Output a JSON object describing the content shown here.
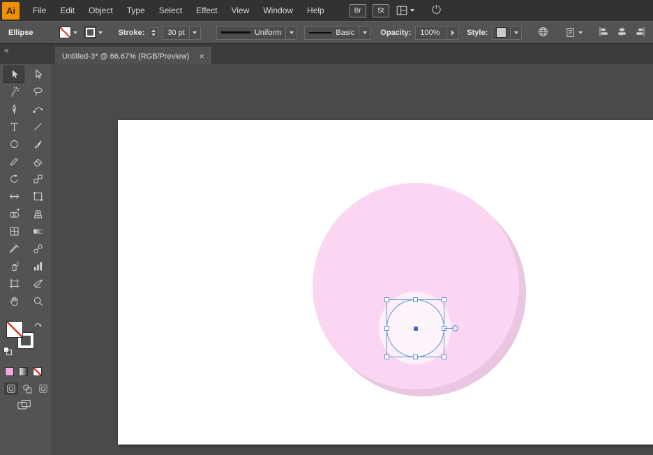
{
  "menu": {
    "logo_text": "Ai",
    "items": [
      "File",
      "Edit",
      "Object",
      "Type",
      "Select",
      "Effect",
      "View",
      "Window",
      "Help"
    ],
    "bridge_badge": "Br",
    "stock_badge": "St"
  },
  "control_bar": {
    "tool_name": "Ellipse",
    "stroke_label": "Stroke:",
    "stroke_value": "30 pt",
    "width_profile": "Uniform",
    "brush": "Basic",
    "opacity_label": "Opacity:",
    "opacity_value": "100%",
    "style_label": "Style:"
  },
  "tab": {
    "title": "Untitled-3* @ 66.67% (RGB/Preview)",
    "close_glyph": "×"
  },
  "panel": {
    "collapse_glyph": "«"
  },
  "tools": {
    "selected": "Selection",
    "names": [
      "Selection",
      "Direct Selection",
      "Magic Wand",
      "Lasso",
      "Pen",
      "Curvature",
      "Type",
      "Line Segment",
      "Ellipse",
      "Paintbrush",
      "Pencil",
      "Eraser",
      "Rotate",
      "Scale",
      "Width",
      "Free Transform",
      "Shape Builder",
      "Perspective Grid",
      "Mesh",
      "Gradient",
      "Eyedropper",
      "Blend",
      "Symbol Sprayer",
      "Column Graph",
      "Artboard",
      "Slice",
      "Hand",
      "Zoom"
    ]
  },
  "toolbar_swatches": {
    "fill": "none",
    "color_swatch": "#efa9dc"
  },
  "artwork": {
    "outer_circle_color": "#fbd6f3",
    "shadow_color": "#e9c6e1",
    "halo_color": "#ffffff",
    "inner_circle_color": "#fdf4fc",
    "selection_color": "#5e93d4"
  }
}
